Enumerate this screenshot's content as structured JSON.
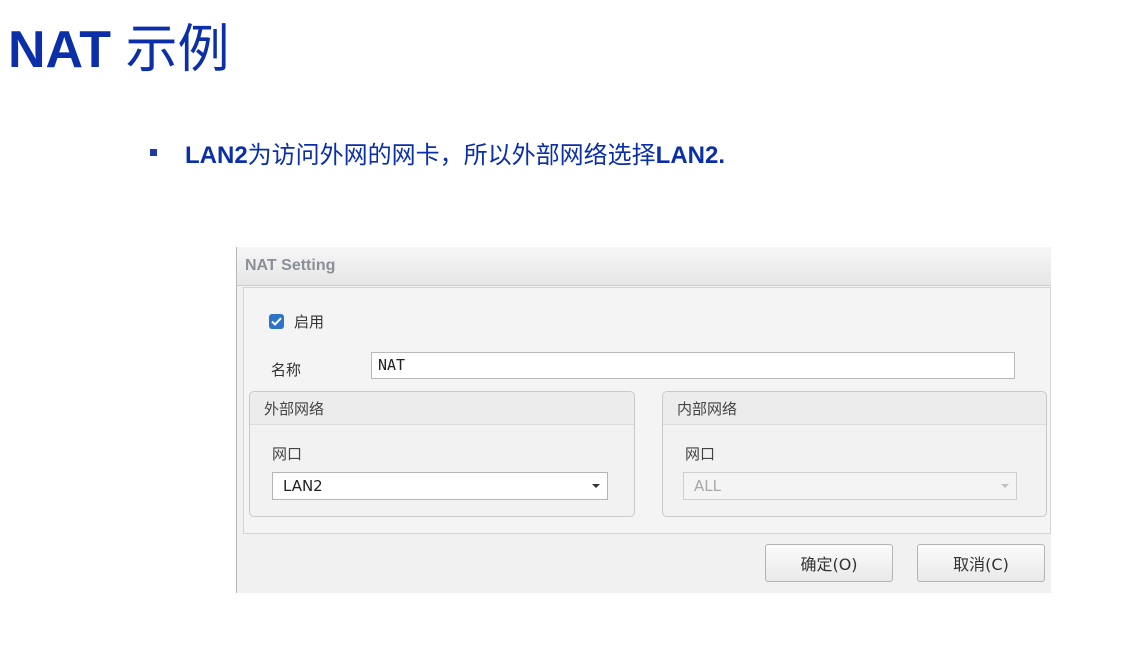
{
  "slide": {
    "title_latin": "NAT",
    "title_cjk": "示例",
    "bullet": {
      "b1": "LAN2",
      "text1": "为访问外网的网卡，所以外部网络选择",
      "b2": "LAN2."
    }
  },
  "dialog": {
    "title": "NAT Setting",
    "enable_label": "启用",
    "enable_checked": true,
    "name_label": "名称",
    "name_value": "NAT",
    "external_group": {
      "title": "外部网络",
      "port_label": "网口",
      "port_value": "LAN2"
    },
    "internal_group": {
      "title": "内部网络",
      "port_label": "网口",
      "port_value": "ALL"
    },
    "ok_label": "确定(O)",
    "cancel_label": "取消(C)"
  },
  "colors": {
    "title": "#0b2fa8",
    "checkbox": "#2d74c8",
    "dialog_bg": "#f1f1f1"
  }
}
